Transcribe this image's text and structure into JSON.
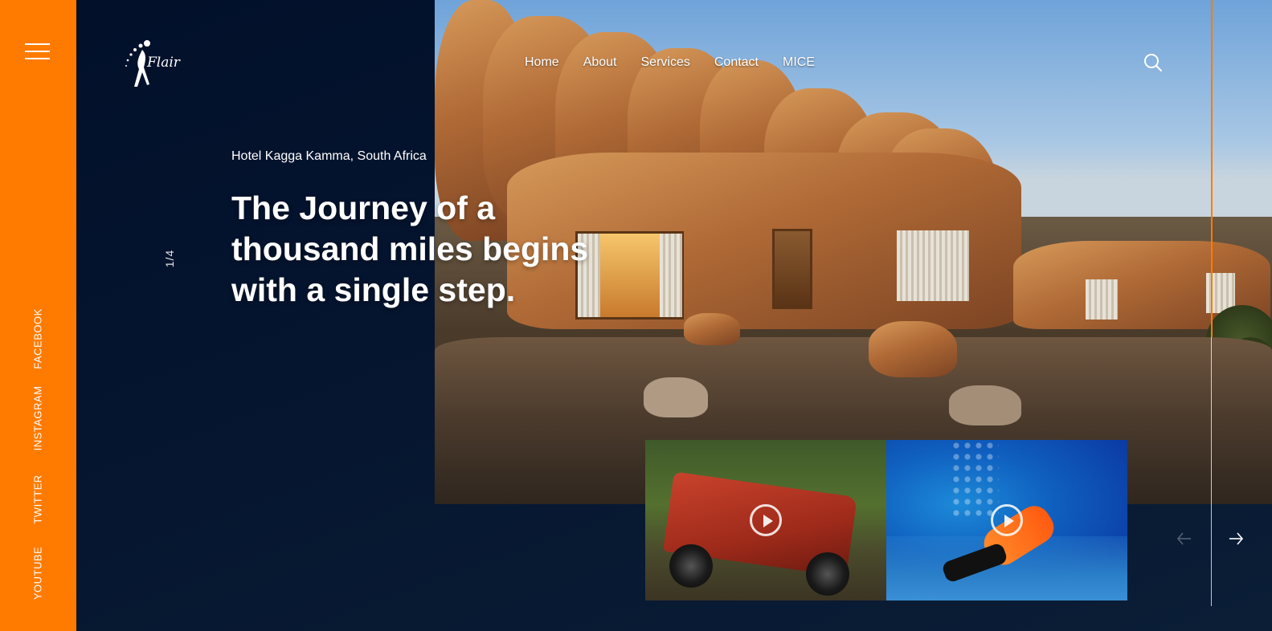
{
  "sidebar": {
    "menu_icon": "hamburger-menu-icon",
    "social_links": [
      {
        "label": "FACEBOOK"
      },
      {
        "label": "INSTAGRAM"
      },
      {
        "label": "TWITTER"
      },
      {
        "label": "YOUTUBE"
      }
    ]
  },
  "header": {
    "logo_text": "Flair",
    "nav": [
      {
        "label": "Home"
      },
      {
        "label": "About"
      },
      {
        "label": "Services"
      },
      {
        "label": "Contact"
      },
      {
        "label": "MICE"
      }
    ],
    "search_icon": "search-icon"
  },
  "hero": {
    "location": "Hotel Kagga Kamma, South Africa",
    "headline": "The Journey of a thousand miles begins with a single step.",
    "slide_counter": "1/4",
    "current_slide": 1,
    "total_slides": 4
  },
  "thumbnails": [
    {
      "subject": "red off-road vehicle",
      "icon": "play-icon"
    },
    {
      "subject": "scuba diver underwater",
      "icon": "play-icon"
    }
  ],
  "slider_controls": {
    "prev_icon": "arrow-left-icon",
    "next_icon": "arrow-right-icon"
  },
  "colors": {
    "accent": "#ff7b00",
    "background": "#061328",
    "text": "#ffffff"
  }
}
